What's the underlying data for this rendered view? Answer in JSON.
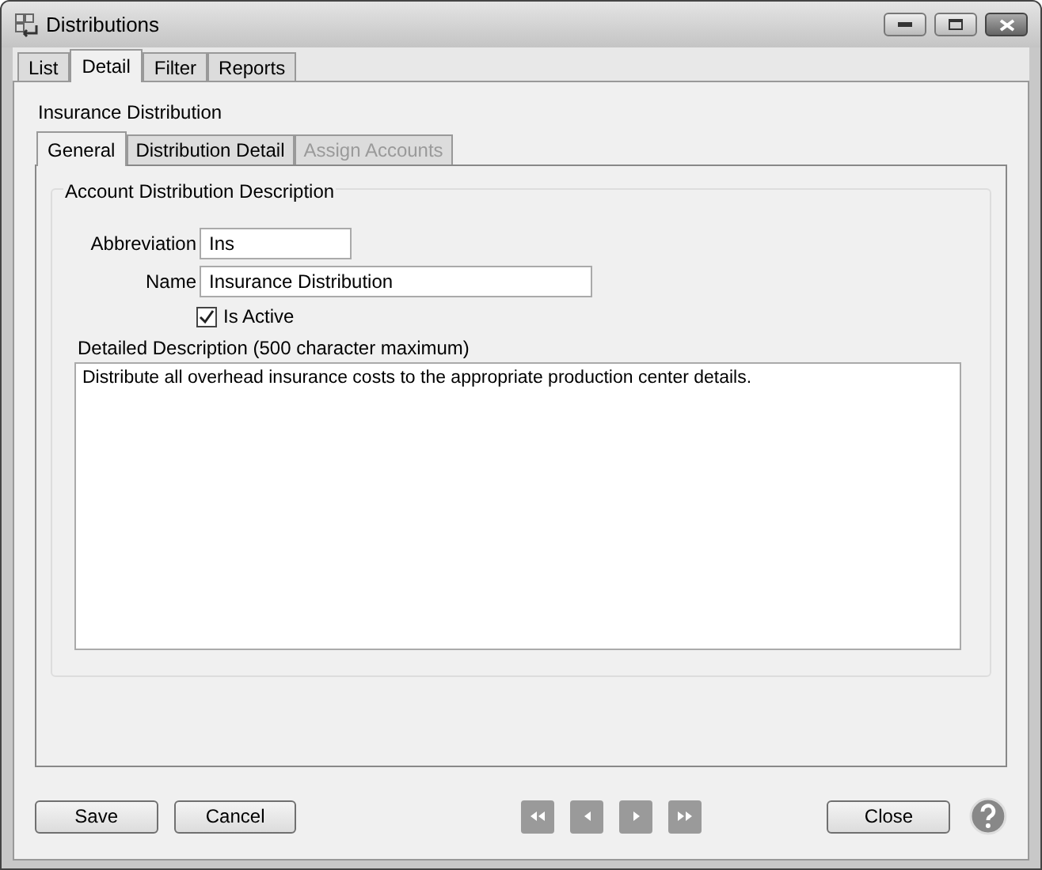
{
  "window": {
    "title": "Distributions"
  },
  "tabs": [
    {
      "label": "List",
      "selected": false
    },
    {
      "label": "Detail",
      "selected": true
    },
    {
      "label": "Filter",
      "selected": false
    },
    {
      "label": "Reports",
      "selected": false
    }
  ],
  "record_title": "Insurance Distribution",
  "sub_tabs": [
    {
      "label": "General",
      "selected": true,
      "disabled": false
    },
    {
      "label": "Distribution Detail",
      "selected": false,
      "disabled": false
    },
    {
      "label": "Assign Accounts",
      "selected": false,
      "disabled": true
    }
  ],
  "group": {
    "title": "Account Distribution Description",
    "abbreviation": {
      "label": "Abbreviation",
      "value": "Ins"
    },
    "name": {
      "label": "Name",
      "value": "Insurance Distribution"
    },
    "is_active": {
      "label": "Is Active",
      "checked": true
    },
    "description": {
      "label": "Detailed Description (500 character maximum)",
      "value": "Distribute all overhead insurance costs to the appropriate production center details."
    }
  },
  "buttons": {
    "save": "Save",
    "cancel": "Cancel",
    "close": "Close"
  },
  "nav_buttons": [
    {
      "kind": "first",
      "disabled": true
    },
    {
      "kind": "previous",
      "disabled": true
    },
    {
      "kind": "next",
      "disabled": true
    },
    {
      "kind": "last",
      "disabled": true
    }
  ]
}
